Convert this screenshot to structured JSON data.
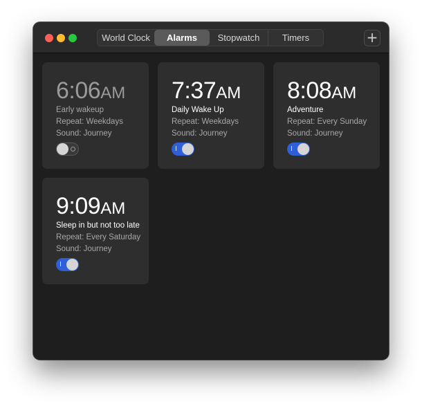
{
  "tabs": [
    {
      "label": "World Clock",
      "active": false
    },
    {
      "label": "Alarms",
      "active": true
    },
    {
      "label": "Stopwatch",
      "active": false
    },
    {
      "label": "Timers",
      "active": false
    }
  ],
  "add_button": {
    "label": "+"
  },
  "alarms": [
    {
      "time": "6:06",
      "ampm": "AM",
      "label": "Early wakeup",
      "repeat": "Repeat: Weekdays",
      "sound": "Sound: Journey",
      "enabled": false
    },
    {
      "time": "7:37",
      "ampm": "AM",
      "label": "Daily Wake Up",
      "repeat": "Repeat: Weekdays",
      "sound": "Sound: Journey",
      "enabled": true
    },
    {
      "time": "8:08",
      "ampm": "AM",
      "label": "Adventure",
      "repeat": "Repeat: Every Sunday",
      "sound": "Sound: Journey",
      "enabled": true
    },
    {
      "time": "9:09",
      "ampm": "AM",
      "label": "Sleep in but not too late",
      "repeat": "Repeat: Every Saturday",
      "sound": "Sound: Journey",
      "enabled": true
    }
  ],
  "colors": {
    "accent": "#2f5fd6",
    "close": "#fe5f57",
    "minimize": "#febc2e",
    "zoom": "#28c840"
  }
}
